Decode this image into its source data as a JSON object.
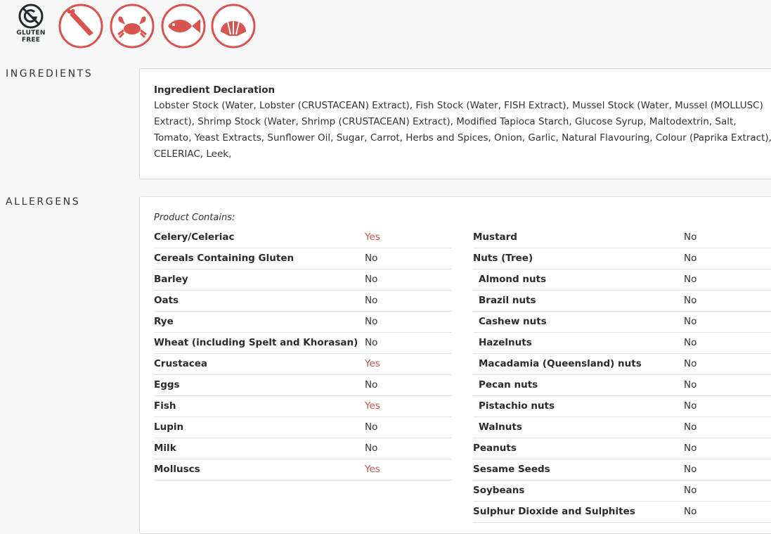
{
  "badges": {
    "gluten_free_label_1": "GLUTEN",
    "gluten_free_label_2": "FREE",
    "icons": [
      {
        "name": "celery-icon",
        "color": "#d9534f"
      },
      {
        "name": "crab-icon",
        "color": "#d9534f"
      },
      {
        "name": "fish-icon",
        "color": "#d9534f"
      },
      {
        "name": "shell-icon",
        "color": "#d9534f"
      }
    ]
  },
  "ingredients": {
    "title": "INGREDIENTS",
    "declaration_heading": "Ingredient Declaration",
    "declaration_text": "Lobster Stock (Water, Lobster (CRUSTACEAN) Extract), Fish Stock (Water, FISH Extract), Mussel Stock (Water, Mussel (MOLLUSC) Extract), Shrimp Stock (Water, Shrimp (CRUSTACEAN) Extract), Modified Tapioca Starch, Glucose Syrup, Maltodextrin, Salt, Tomato, Yeast Extracts, Sunflower Oil, Sugar, Carrot, Herbs and Spices, Onion, Garlic, Natural Flavouring, Colour (Paprika Extract), CELERIAC, Leek,"
  },
  "allergens": {
    "title": "ALLERGENS",
    "contains_label": "Product Contains:",
    "yes_color": "#c9504f",
    "left": [
      {
        "name": "Celery/Celeriac",
        "value": "Yes"
      },
      {
        "name": "Cereals Containing Gluten",
        "value": "No"
      },
      {
        "name": "Barley",
        "value": "No"
      },
      {
        "name": "Oats",
        "value": "No"
      },
      {
        "name": "Rye",
        "value": "No"
      },
      {
        "name": "Wheat (including Spelt and Khorasan)",
        "value": "No"
      },
      {
        "name": "Crustacea",
        "value": "Yes"
      },
      {
        "name": "Eggs",
        "value": "No"
      },
      {
        "name": "Fish",
        "value": "Yes"
      },
      {
        "name": "Lupin",
        "value": "No"
      },
      {
        "name": "Milk",
        "value": "No"
      },
      {
        "name": "Molluscs",
        "value": "Yes"
      }
    ],
    "right": [
      {
        "name": "Mustard",
        "value": "No"
      },
      {
        "name": "Nuts (Tree)",
        "value": "No"
      },
      {
        "name": "Almond nuts",
        "value": "No",
        "sub": true
      },
      {
        "name": "Brazil nuts",
        "value": "No",
        "sub": true
      },
      {
        "name": "Cashew nuts",
        "value": "No",
        "sub": true
      },
      {
        "name": "Hazelnuts",
        "value": "No",
        "sub": true
      },
      {
        "name": "Macadamia (Queensland) nuts",
        "value": "No",
        "sub": true
      },
      {
        "name": "Pecan nuts",
        "value": "No",
        "sub": true
      },
      {
        "name": "Pistachio nuts",
        "value": "No",
        "sub": true
      },
      {
        "name": "Walnuts",
        "value": "No",
        "sub": true
      },
      {
        "name": "Peanuts",
        "value": "No"
      },
      {
        "name": "Sesame Seeds",
        "value": "No"
      },
      {
        "name": "Soybeans",
        "value": "No"
      },
      {
        "name": "Sulphur Dioxide and Sulphites",
        "value": "No"
      }
    ]
  }
}
